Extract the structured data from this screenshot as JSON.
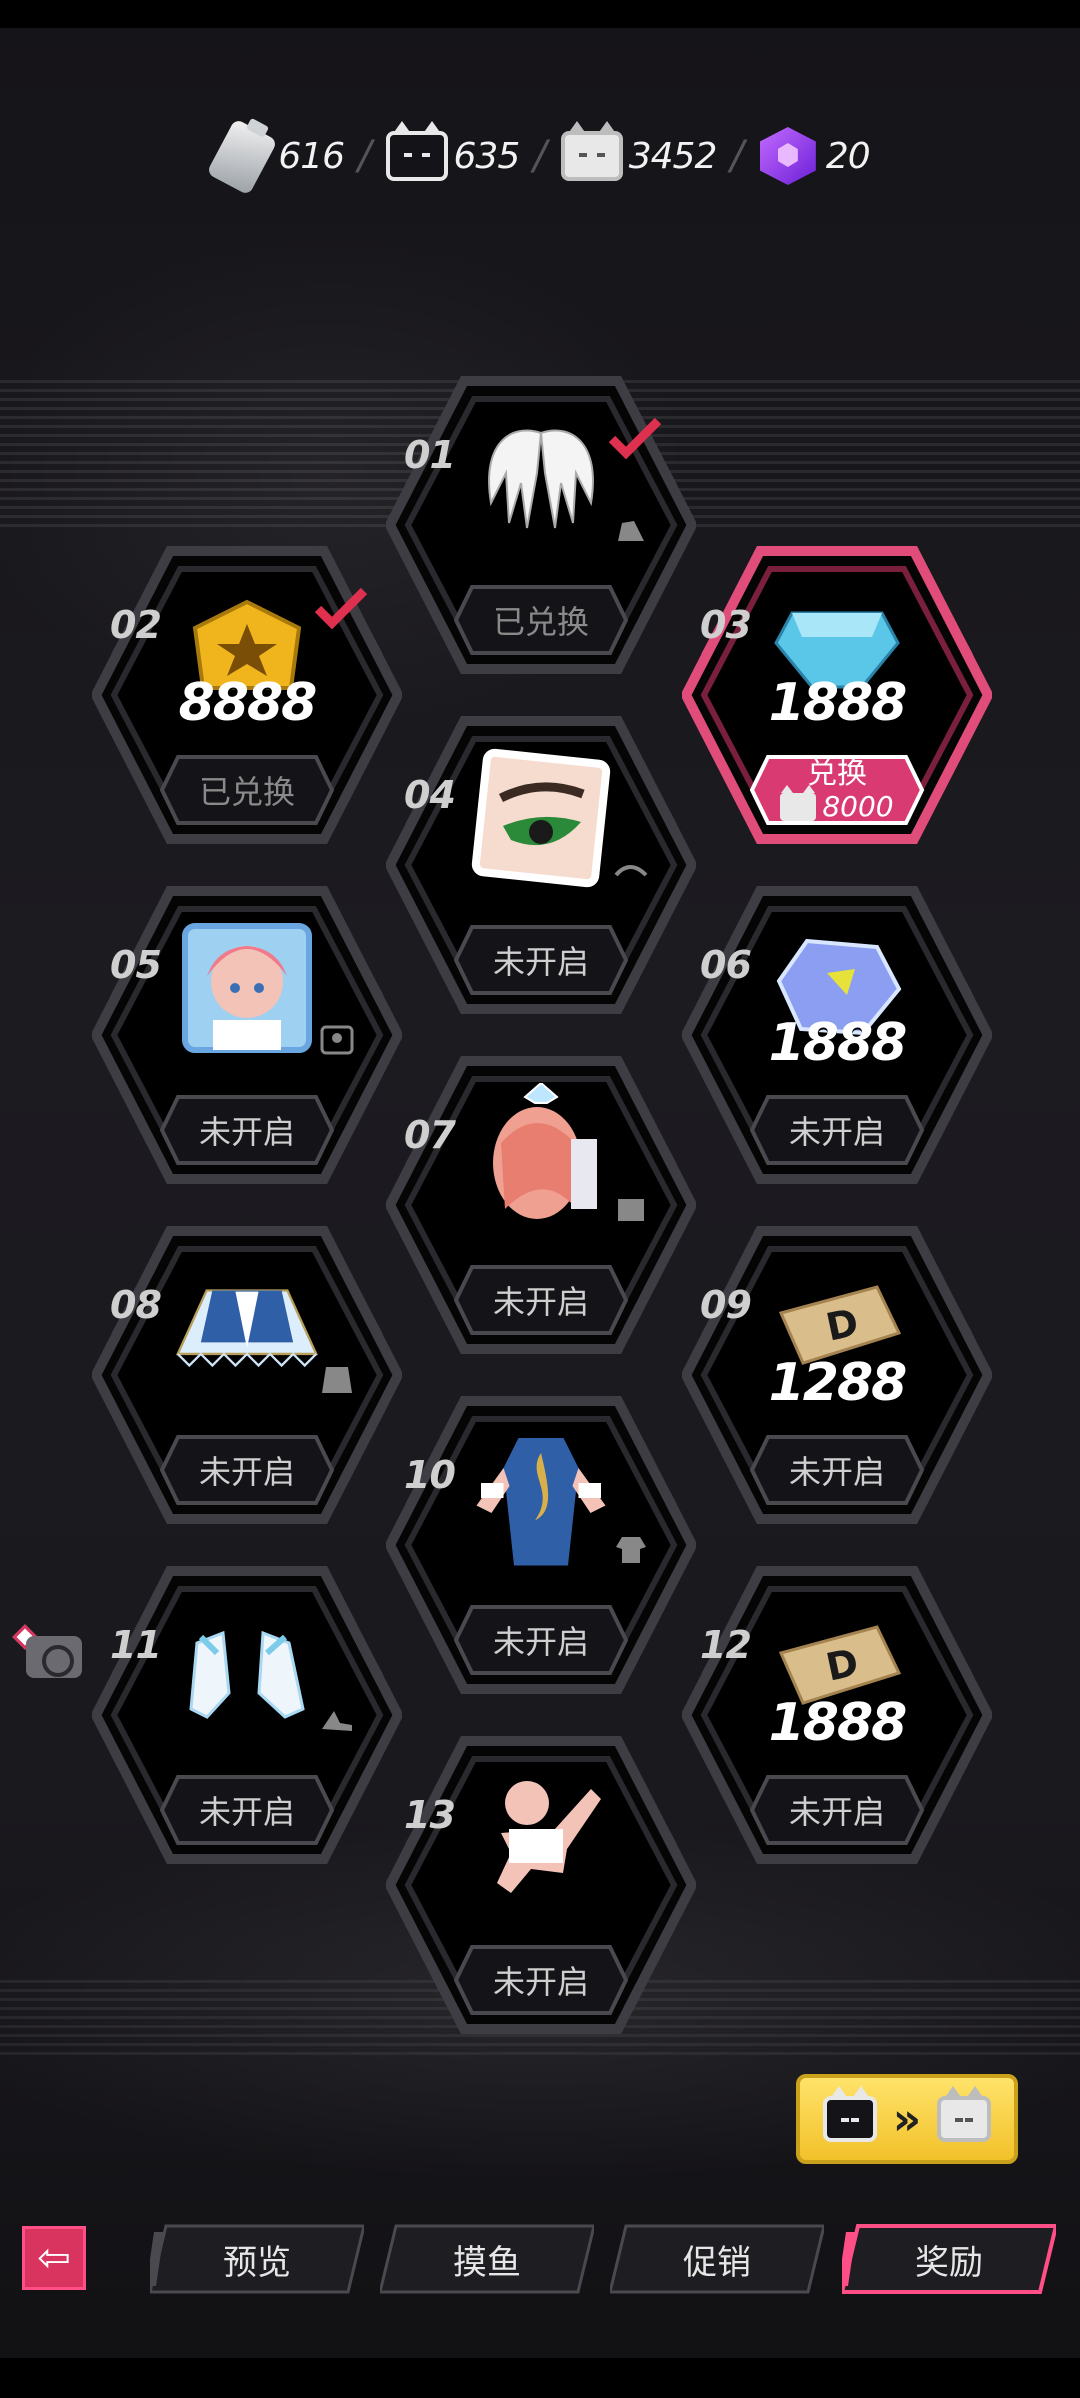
{
  "currencies": [
    {
      "icon": "milk-bottle-icon",
      "value": "616"
    },
    {
      "icon": "black-cat-token-icon",
      "value": "635"
    },
    {
      "icon": "white-cat-token-icon",
      "value": "3452"
    },
    {
      "icon": "purple-cube-icon",
      "value": "20"
    }
  ],
  "separator": "/",
  "rewards": [
    {
      "num": "01",
      "item": "white-wings-icon",
      "amount": "",
      "button": "已兑换",
      "state": "redeemed"
    },
    {
      "num": "02",
      "item": "gold-badge-icon",
      "amount": "8888",
      "button": "已兑换",
      "state": "redeemed"
    },
    {
      "num": "03",
      "item": "blue-gem-icon",
      "amount": "1888",
      "button": "兑换",
      "cost": "8000",
      "state": "redeemable"
    },
    {
      "num": "04",
      "item": "eye-makeup-icon",
      "amount": "",
      "button": "未开启",
      "state": "locked"
    },
    {
      "num": "05",
      "item": "avatar-portrait-icon",
      "amount": "",
      "button": "未开启",
      "state": "locked"
    },
    {
      "num": "06",
      "item": "crystal-gem-icon",
      "amount": "1888",
      "button": "未开启",
      "state": "locked"
    },
    {
      "num": "07",
      "item": "pink-hair-icon",
      "amount": "",
      "button": "未开启",
      "state": "locked"
    },
    {
      "num": "08",
      "item": "blue-skirt-icon",
      "amount": "",
      "button": "未开启",
      "state": "locked"
    },
    {
      "num": "09",
      "item": "gold-coupon-icon",
      "amount": "1288",
      "button": "未开启",
      "state": "locked"
    },
    {
      "num": "10",
      "item": "blue-dress-icon",
      "amount": "",
      "button": "未开启",
      "state": "locked"
    },
    {
      "num": "11",
      "item": "white-shoes-icon",
      "amount": "",
      "button": "未开启",
      "state": "locked"
    },
    {
      "num": "12",
      "item": "gold-coupon-icon",
      "amount": "1888",
      "button": "未开启",
      "state": "locked"
    },
    {
      "num": "13",
      "item": "pose-action-icon",
      "amount": "",
      "button": "未开启",
      "state": "locked"
    }
  ],
  "convert": {
    "arrow": "»"
  },
  "back": {
    "symbol": "⇦"
  },
  "tabs": [
    {
      "label": "预览",
      "active": false
    },
    {
      "label": "摸鱼",
      "active": false
    },
    {
      "label": "促销",
      "active": false
    },
    {
      "label": "奖励",
      "active": true
    }
  ],
  "colors": {
    "accent": "#ff4f86",
    "redeem_gold": "#f2c12a",
    "check_red": "#e03050"
  }
}
